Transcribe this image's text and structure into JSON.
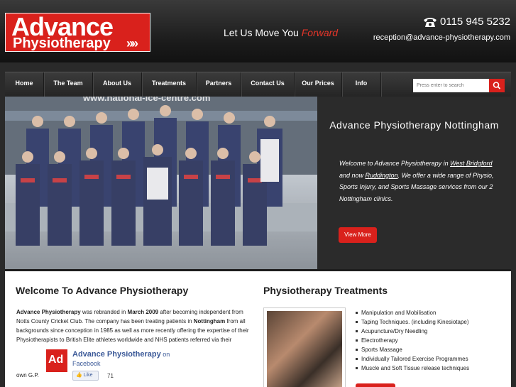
{
  "header": {
    "logo_line1": "Advance",
    "logo_line2": "Physiotherapy",
    "logo_chevrons": "»»",
    "tagline_main": "Let Us Move You ",
    "tagline_accent": "Forward",
    "phone": "0115 945 5232",
    "phone_icon": "phone-icon",
    "email": "reception@advance-physiotherapy.com"
  },
  "nav": {
    "items": [
      {
        "label": "Home",
        "width": 55
      },
      {
        "label": "The Team",
        "width": 69
      },
      {
        "label": "About Us",
        "width": 69
      },
      {
        "label": "Treatments",
        "width": 77
      },
      {
        "label": "Partners",
        "width": 63
      },
      {
        "label": "Contact Us",
        "width": 75
      },
      {
        "label": "Our Prices",
        "width": 67
      },
      {
        "label": "Info",
        "width": 55
      }
    ],
    "search_placeholder": "Press enter to search",
    "search_icon": "search-icon"
  },
  "hero": {
    "photo_banner_text": "www.national-ice-centre.com",
    "title": "Advance Physiotherapy Nottingham",
    "text_1": "Welcome to Advance Physiotherapy in ",
    "link_west": "West Bridgford",
    "text_2": " and now ",
    "link_rudd": "Ruddington",
    "text_3": ".  We offer a wide range of Physio, Sports Injury, and Sports Massage services from our 2 Nottingham clinics.",
    "button": "View More"
  },
  "welcome": {
    "heading": "Welcome To Advance Physiotherapy",
    "p_bold1": "Advance Physiotherapy",
    "p_1": " was rebranded in ",
    "p_bold2": "March 2009",
    "p_2": " after becoming independent from Notts County Cricket Club. The company has been treating patients in ",
    "p_bold3": "Nottingham",
    "p_3": " from all backgrounds since conception in 1985 as well as more recently offering the expertise of their Physiotherapists to British Elite athletes worldwide and NHS patients referred via their",
    "own_gp": "own G.P.",
    "fb_logo": "Ad",
    "fb_name": "Advance Physiotherapy",
    "fb_on": " on",
    "fb_sub": "Facebook",
    "fb_like": "Like",
    "fb_count": "71"
  },
  "treatments": {
    "heading": "Physiotherapy Treatments",
    "items": [
      "Manipulation and Mobilisation",
      "Taping Techniques. (including Kinesiotape)",
      "Acupuncture/Dry Needling",
      "Electrotherapy",
      "Sports Massage",
      "Individually Tailored Exercise Programmes",
      "Muscle and Soft Tissue release techniques"
    ]
  },
  "colors": {
    "brand_red": "#d9211c",
    "dark_bg": "#2a2a2a",
    "facebook_blue": "#3b5998"
  }
}
